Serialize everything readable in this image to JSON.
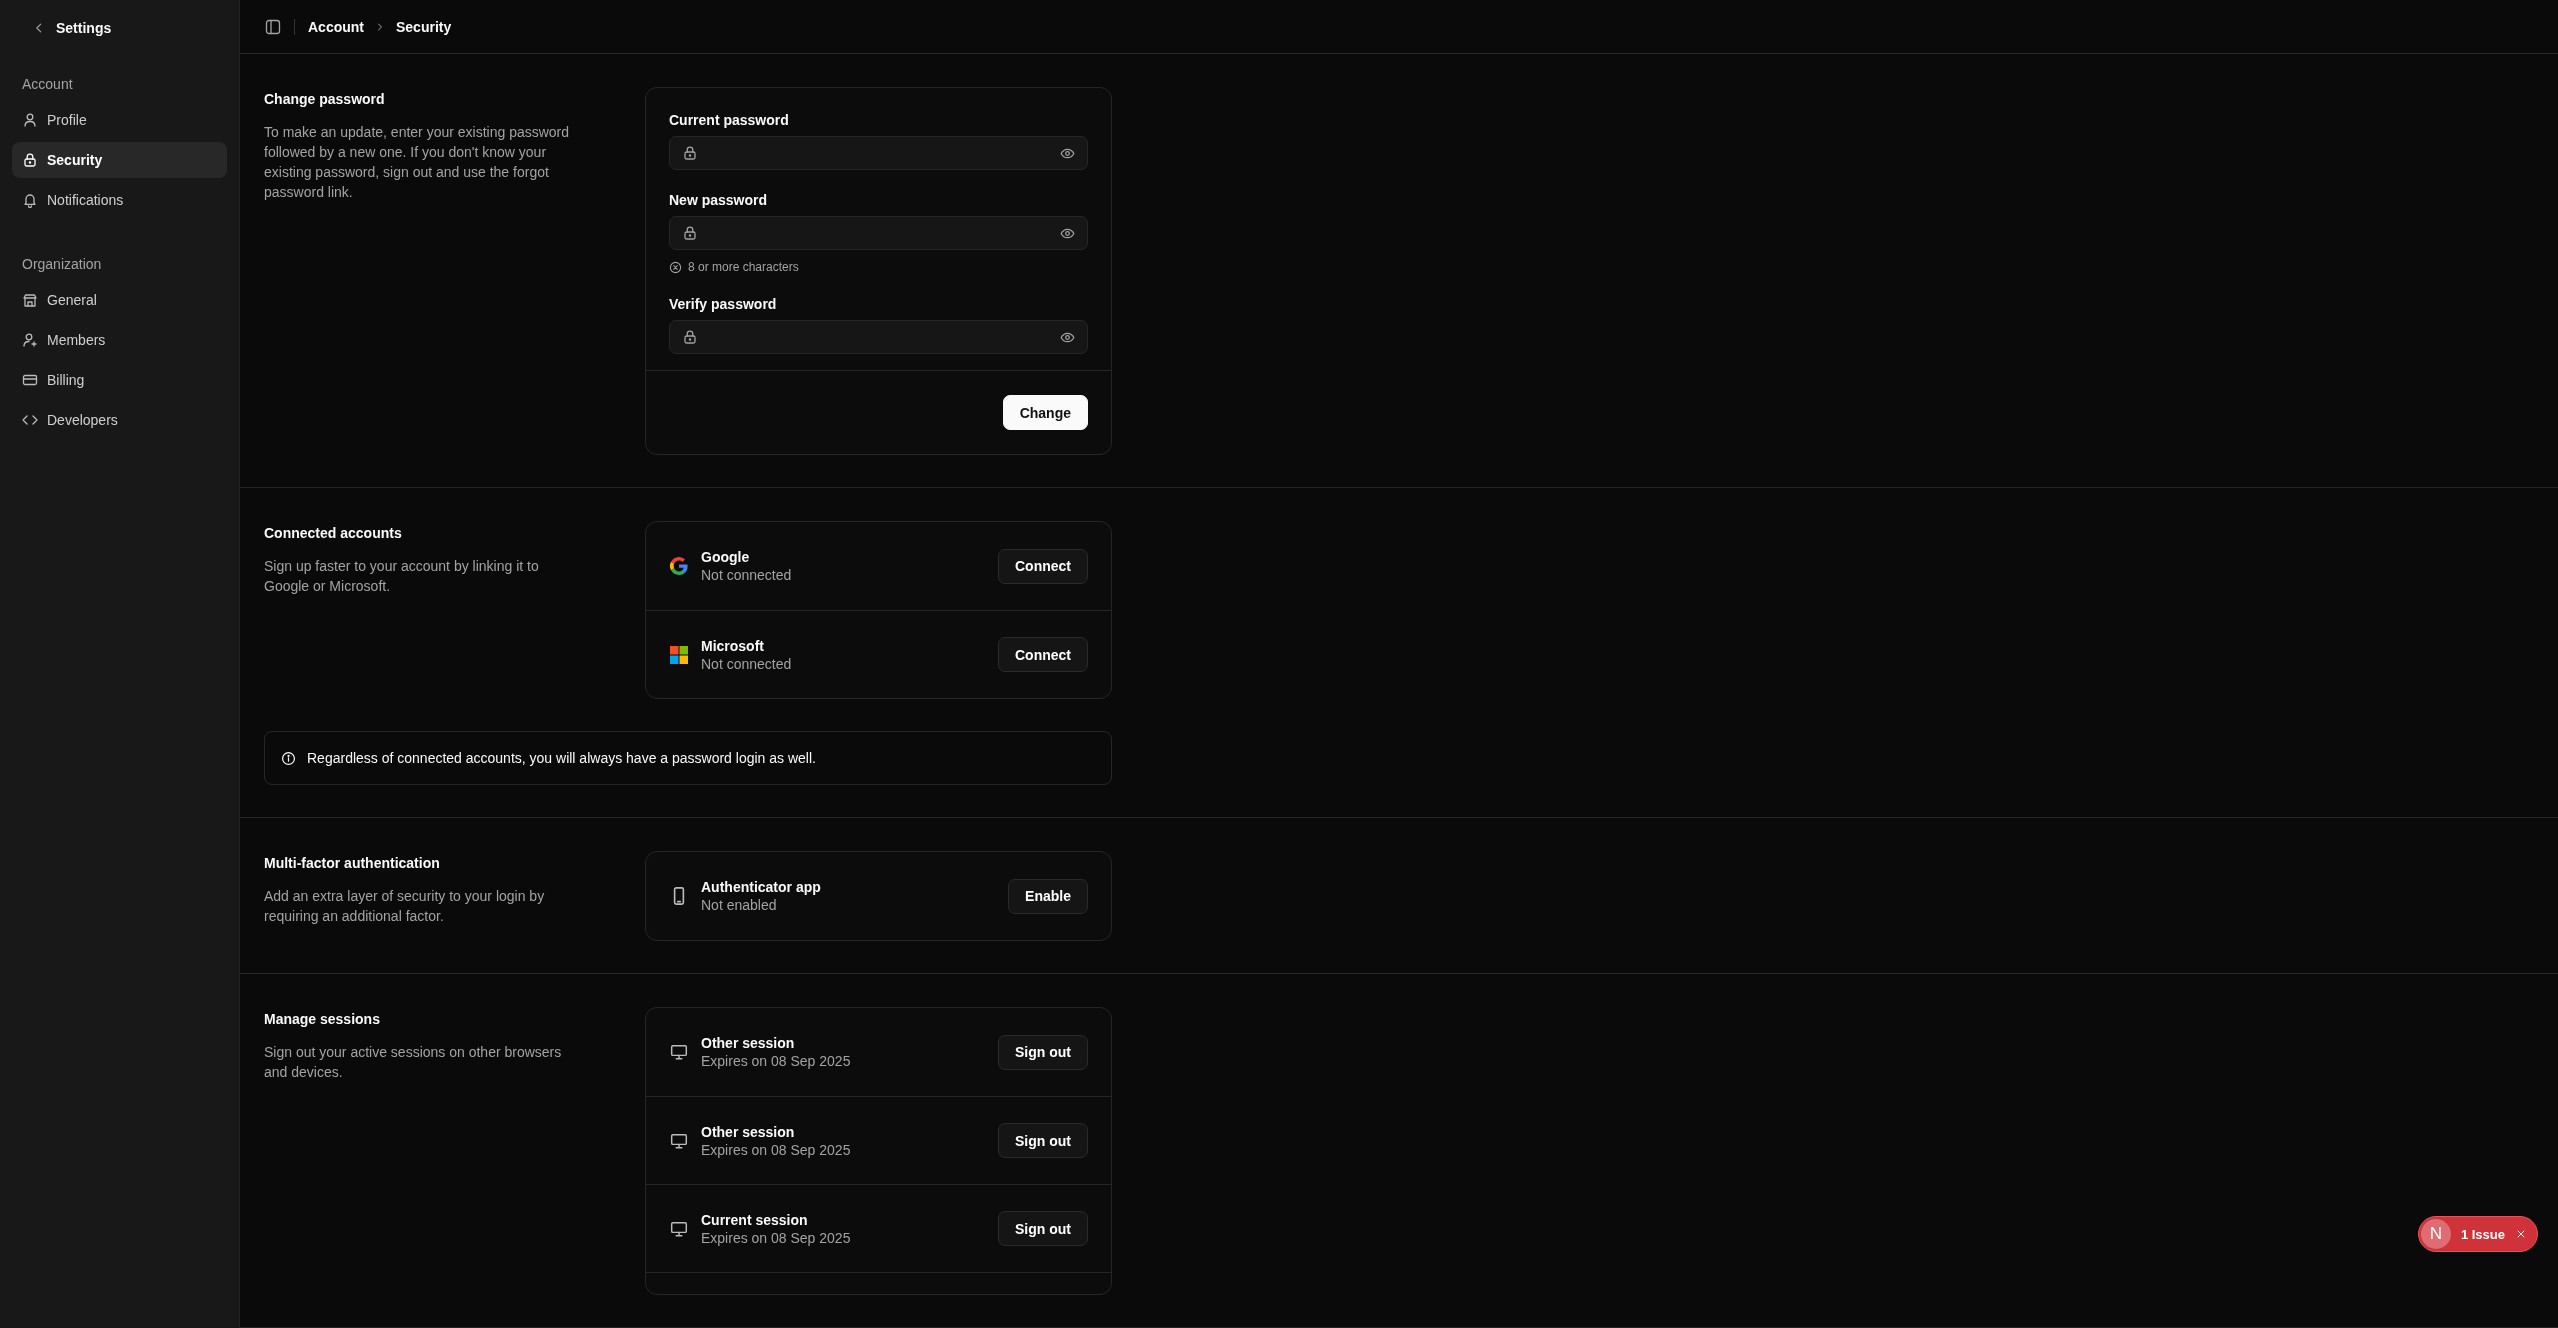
{
  "sidebar": {
    "back_label": "Settings",
    "groups": [
      {
        "title": "Account",
        "items": [
          {
            "label": "Profile",
            "selected": false
          },
          {
            "label": "Security",
            "selected": true
          },
          {
            "label": "Notifications",
            "selected": false
          }
        ]
      },
      {
        "title": "Organization",
        "items": [
          {
            "label": "General",
            "selected": false
          },
          {
            "label": "Members",
            "selected": false
          },
          {
            "label": "Billing",
            "selected": false
          },
          {
            "label": "Developers",
            "selected": false
          }
        ]
      }
    ]
  },
  "breadcrumb": [
    "Account",
    "Security"
  ],
  "sections": [
    {
      "kind": "password",
      "title": "Change password",
      "description": "To make an update, enter your existing password followed by a new one. If you don't know your existing password, sign out and use the forgot password link.",
      "fields": [
        {
          "label": "Current password"
        },
        {
          "label": "New password",
          "requirement": {
            "text": "8 or more characters",
            "met": false
          }
        },
        {
          "label": "Verify password"
        }
      ],
      "submit": "Change"
    },
    {
      "kind": "accounts",
      "title": "Connected accounts",
      "description": "Sign up faster to your account by linking it to Google or Microsoft.",
      "providers": [
        {
          "name": "Google",
          "status": "Not connected",
          "action": "Connect"
        },
        {
          "name": "Microsoft",
          "status": "Not connected",
          "action": "Connect"
        }
      ],
      "notice": "Regardless of connected accounts, you will always have a password login as well."
    },
    {
      "kind": "mfa",
      "title": "Multi-factor authentication",
      "description": "Add an extra layer of security to your login by requiring an additional factor.",
      "methods": [
        {
          "name": "Authenticator app",
          "status": "Not enabled",
          "action": "Enable"
        }
      ]
    },
    {
      "kind": "sessions",
      "title": "Manage sessions",
      "description": "Sign out your active sessions on other browsers and devices.",
      "sessions": [
        {
          "name": "Other session",
          "expiry": "Expires on 08 Sep 2025",
          "action": "Sign out"
        },
        {
          "name": "Other session",
          "expiry": "Expires on 08 Sep 2025",
          "action": "Sign out"
        },
        {
          "name": "Current session",
          "expiry": "Expires on 08 Sep 2025",
          "action": "Sign out"
        }
      ]
    }
  ],
  "issue_badge": {
    "logo": "N",
    "label": "1 Issue"
  }
}
